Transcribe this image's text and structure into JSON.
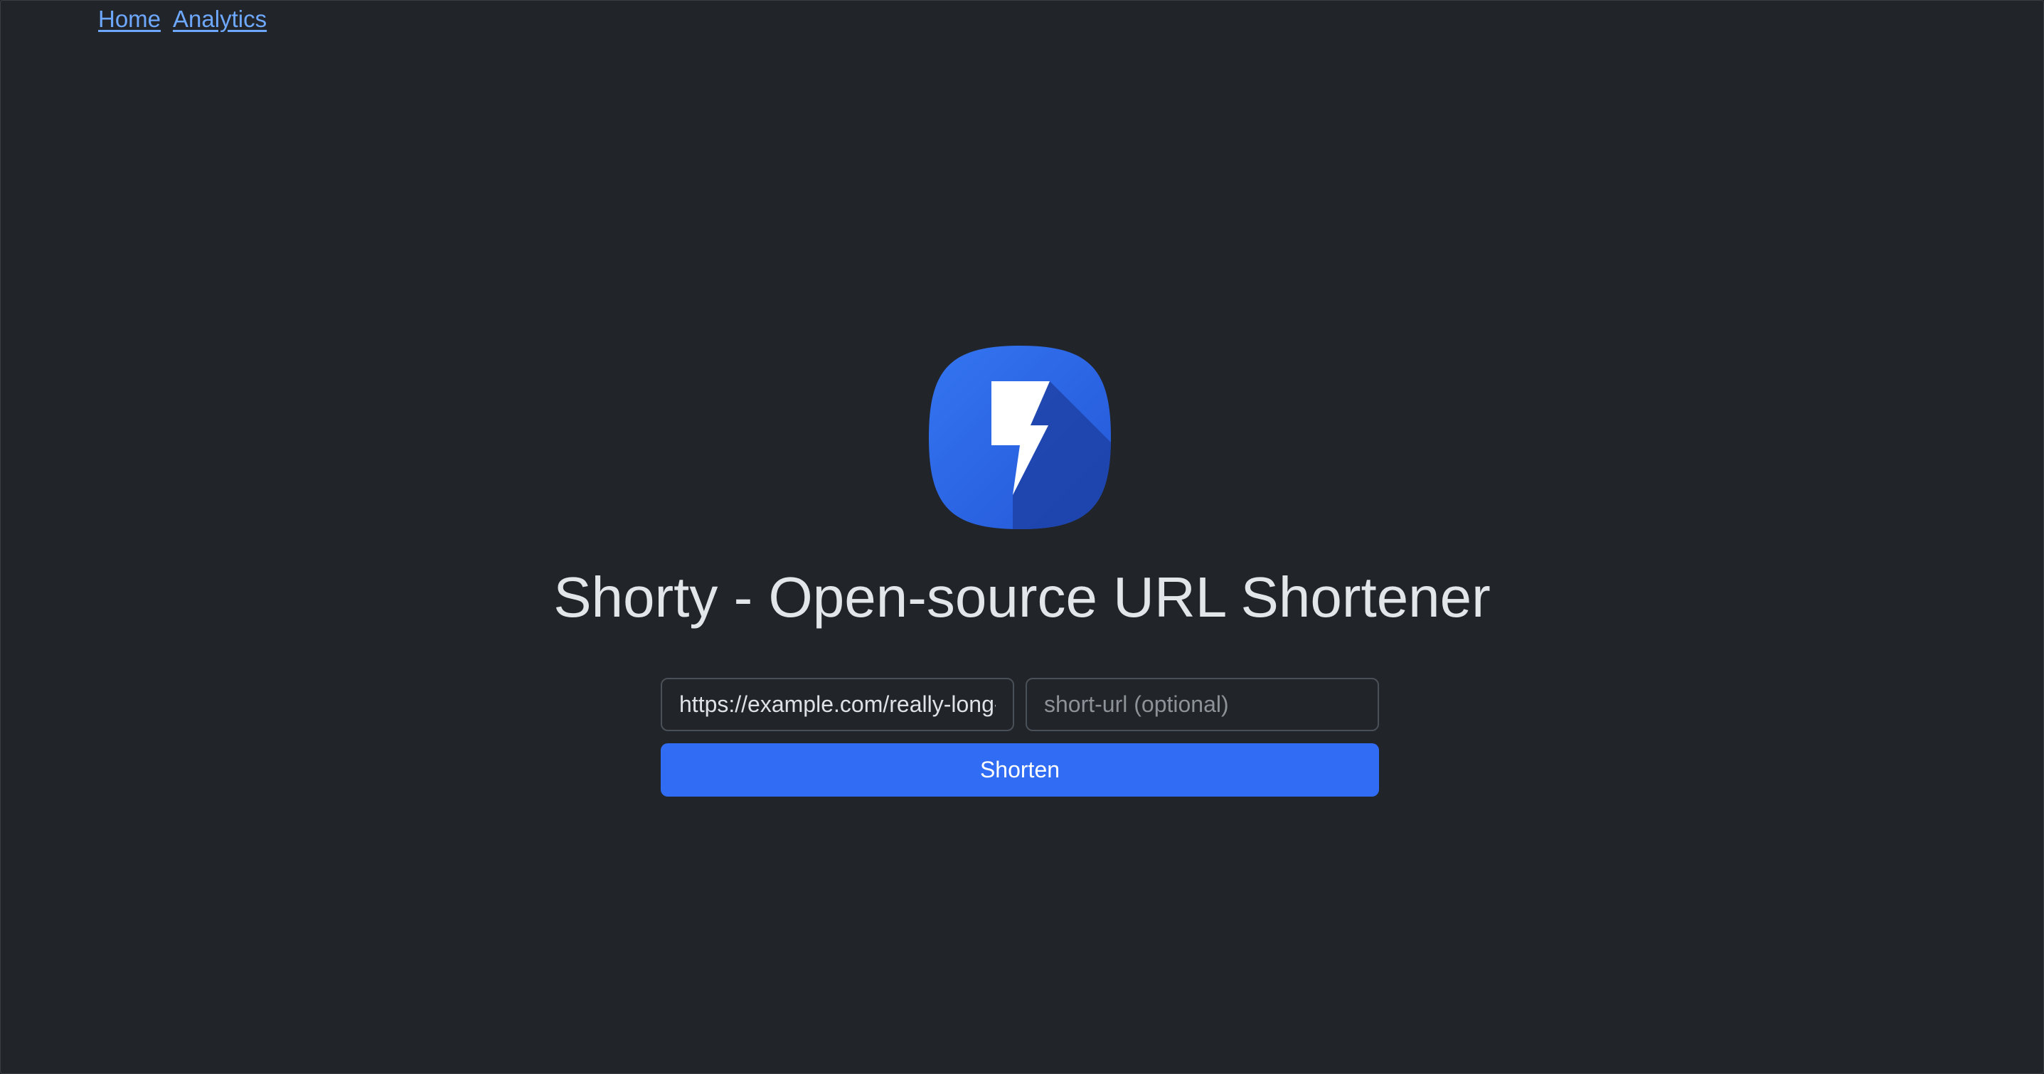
{
  "nav": {
    "home_label": "Home",
    "analytics_label": "Analytics"
  },
  "logo": {
    "icon": "lightning-bolt-icon",
    "colors": [
      "#2f6bf0",
      "#1a3fa0",
      "#ffffff"
    ]
  },
  "page_title": "Shorty - Open-source URL Shortener",
  "form": {
    "long_url_value": "https://example.com/really-long-url",
    "short_url_value": "",
    "short_url_placeholder": "short-url (optional)",
    "submit_label": "Shorten"
  },
  "theme": {
    "background": "#212529",
    "link": "#6ea8fe",
    "primary": "#316cf4"
  }
}
